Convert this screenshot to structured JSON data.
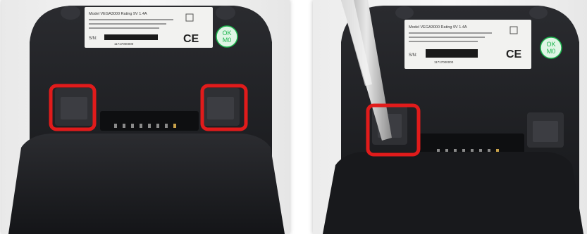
{
  "photos": [
    {
      "label": {
        "model_line": "Model VEGA3000 Rating 9V 1.4A",
        "sn_label": "S/N:",
        "serial": "11717000000",
        "ce_mark": "CE",
        "ok_badge": "OK\nM0"
      }
    },
    {
      "label": {
        "model_line": "Model VEGA3000 Rating 9V 1.4A",
        "sn_label": "S/N:",
        "serial": "11717000000",
        "ce_mark": "CE",
        "ok_badge": "OK\nM0"
      }
    }
  ],
  "colors": {
    "highlight": "#e11b1b",
    "device_body": "#1e1f22",
    "label_bg": "#f2f2f0",
    "badge_green": "#1bb54c"
  }
}
